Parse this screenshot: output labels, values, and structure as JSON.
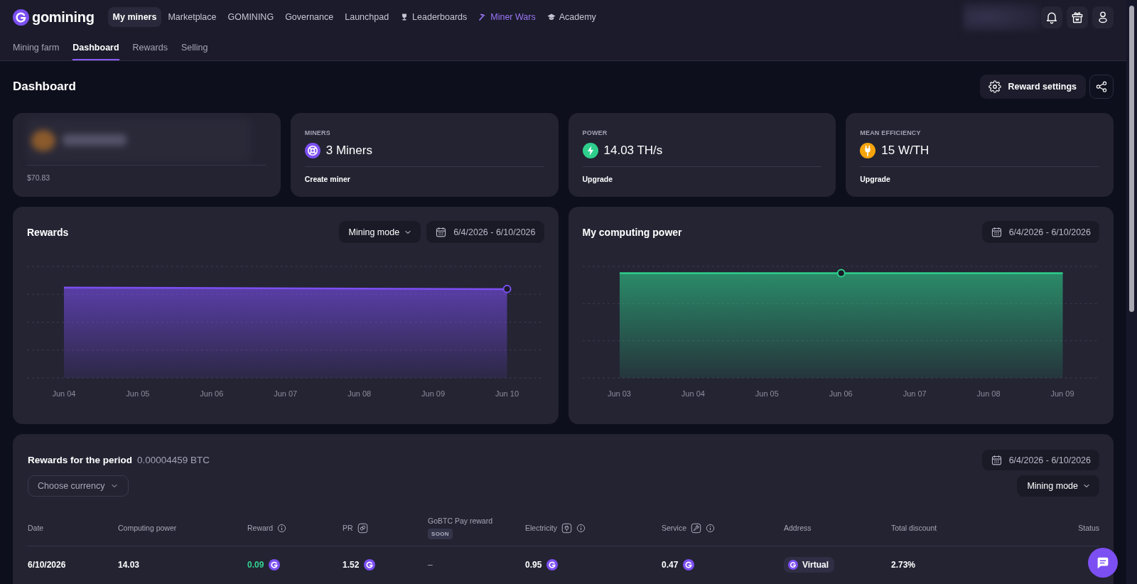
{
  "top_nav": {
    "logo": "gomining",
    "items": [
      {
        "label": "My miners",
        "kind": "link",
        "selected": true,
        "highlighted": false
      },
      {
        "label": "Marketplace",
        "kind": "link",
        "selected": false,
        "highlighted": false
      },
      {
        "label": "GOMINING",
        "kind": "link",
        "selected": false,
        "highlighted": false
      },
      {
        "label": "Governance",
        "kind": "link",
        "selected": false,
        "highlighted": false
      },
      {
        "label": "Launchpad",
        "kind": "link",
        "selected": false,
        "highlighted": false
      },
      {
        "label": "Leaderboards",
        "kind": "leaderboard",
        "selected": false,
        "highlighted": false
      },
      {
        "label": "Miner Wars",
        "kind": "game",
        "selected": false,
        "highlighted": true
      },
      {
        "label": "Academy",
        "kind": "learning",
        "selected": false,
        "highlighted": false
      }
    ]
  },
  "sub_nav": {
    "tabs": [
      {
        "label": "Mining farm",
        "selected": false
      },
      {
        "label": "Dashboard",
        "selected": true
      },
      {
        "label": "Rewards",
        "selected": false
      },
      {
        "label": "Selling",
        "selected": false
      }
    ]
  },
  "page": {
    "title": "Dashboard",
    "reward_settings": "Reward settings"
  },
  "stat_cards": [
    {
      "kind": "balance",
      "footer": "$70.83"
    },
    {
      "kind": "miners",
      "label": "MINERS",
      "value": "3 Miners",
      "link": "Create miner"
    },
    {
      "kind": "power",
      "label": "POWER",
      "value": "14.03 TH/s",
      "link": "Upgrade"
    },
    {
      "kind": "efficiency",
      "label": "MEAN EFFICIENCY",
      "value": "15 W/TH",
      "link": "Upgrade"
    }
  ],
  "charts": [
    {
      "kind": "rewards",
      "title": "Rewards",
      "mode_button": "Mining mode",
      "date_range": "6/4/2026 - 6/10/2026",
      "color": "#7c4ff2",
      "x_labels": [
        "Jun 04",
        "Jun 05",
        "Jun 06",
        "Jun 07",
        "Jun 08",
        "Jun 09",
        "Jun 10"
      ]
    },
    {
      "kind": "power",
      "title": "My computing power",
      "date_range": "6/4/2026 - 6/10/2026",
      "color": "#2ecf8c",
      "x_labels": [
        "Jun 03",
        "Jun 04",
        "Jun 05",
        "Jun 06",
        "Jun 07",
        "Jun 08",
        "Jun 09"
      ]
    }
  ],
  "rewards_table": {
    "title": "Rewards for the period",
    "total": "0.00004459 BTC",
    "date_range": "6/4/2026 - 6/10/2026",
    "currency_select": {
      "placeholder": "Choose currency"
    },
    "mode_button": "Mining mode",
    "columns": [
      {
        "label": "Date",
        "kind": "plain"
      },
      {
        "label": "Computing power",
        "kind": "plain"
      },
      {
        "label": "Reward",
        "kind": "info"
      },
      {
        "label": "PR",
        "kind": "pr"
      },
      {
        "label": "GoBTC Pay reward",
        "kind": "soon",
        "badge": "SOON"
      },
      {
        "label": "Electricity",
        "kind": "electricity"
      },
      {
        "label": "Service",
        "kind": "service"
      },
      {
        "label": "Address",
        "kind": "plain"
      },
      {
        "label": "Total discount",
        "kind": "plain"
      },
      {
        "label": "Status",
        "kind": "plain"
      }
    ],
    "rows": [
      {
        "cells": [
          {
            "text": "6/10/2026",
            "kind": "text"
          },
          {
            "text": "14.03",
            "kind": "text"
          },
          {
            "text": "0.09",
            "kind": "gain"
          },
          {
            "text": "1.52",
            "kind": "coin"
          },
          {
            "text": "–",
            "kind": "muted"
          },
          {
            "text": "0.95",
            "kind": "coin"
          },
          {
            "text": "0.47",
            "kind": "coin"
          },
          {
            "text": "Virtual",
            "kind": "address"
          },
          {
            "text": "2.73%",
            "kind": "text"
          }
        ]
      }
    ]
  }
}
